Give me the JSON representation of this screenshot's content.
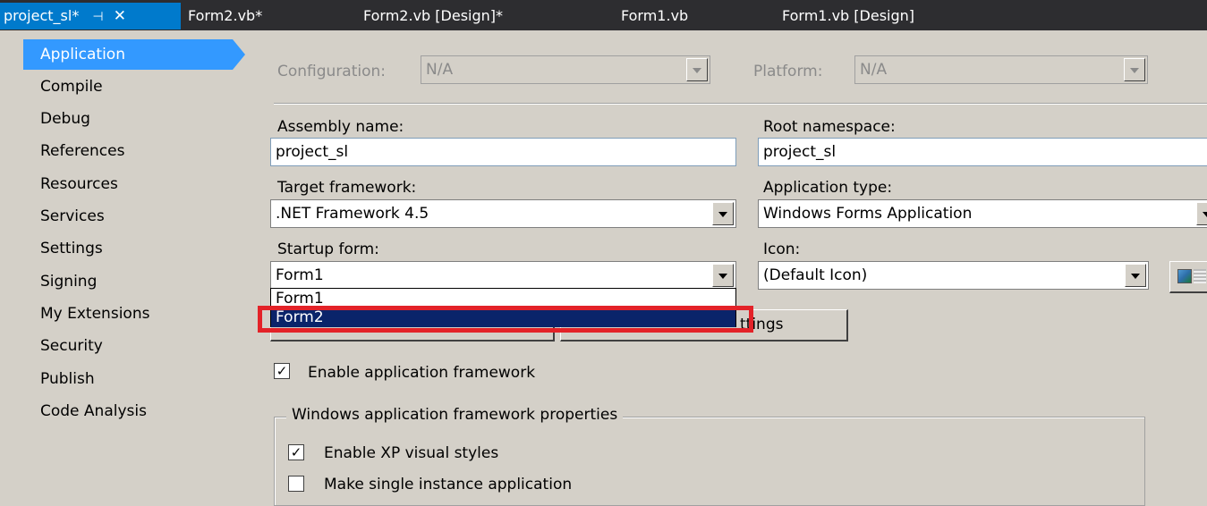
{
  "tabs": [
    {
      "label": "project_sl*",
      "active": true
    },
    {
      "label": "Form2.vb*"
    },
    {
      "label": "Form2.vb [Design]*"
    },
    {
      "label": "Form1.vb"
    },
    {
      "label": "Form1.vb [Design]"
    }
  ],
  "sidebar": {
    "items": [
      {
        "label": "Application",
        "active": true
      },
      {
        "label": "Compile"
      },
      {
        "label": "Debug"
      },
      {
        "label": "References"
      },
      {
        "label": "Resources"
      },
      {
        "label": "Services"
      },
      {
        "label": "Settings"
      },
      {
        "label": "Signing"
      },
      {
        "label": "My Extensions"
      },
      {
        "label": "Security"
      },
      {
        "label": "Publish"
      },
      {
        "label": "Code Analysis"
      }
    ]
  },
  "config": {
    "configuration_label": "Configuration:",
    "configuration_value": "N/A",
    "platform_label": "Platform:",
    "platform_value": "N/A"
  },
  "form": {
    "assembly_name_label": "Assembly name:",
    "assembly_name_value": "project_sl",
    "root_namespace_label": "Root namespace:",
    "root_namespace_value": "project_sl",
    "target_framework_label": "Target framework:",
    "target_framework_value": ".NET Framework 4.5",
    "application_type_label": "Application type:",
    "application_type_value": "Windows Forms Application",
    "startup_form_label": "Startup form:",
    "startup_form_value": "Form1",
    "icon_label": "Icon:",
    "icon_value": "(Default Icon)",
    "startup_options": [
      "Form1",
      "Form2"
    ],
    "selected_option": "Form2",
    "view_settings_button_partial": "ttings",
    "enable_framework_label": "Enable application framework",
    "enable_framework_checked": true
  },
  "framework_group": {
    "title": "Windows application framework properties",
    "xp_styles_label": "Enable XP visual styles",
    "xp_styles_checked": true,
    "single_instance_label": "Make single instance application",
    "single_instance_checked": false
  },
  "colors": {
    "tab_strip": "#2d2d30",
    "active_tab": "#007acc",
    "sidebar_active": "#3399ff",
    "list_selection": "#0a246a",
    "highlight_box": "#e32228",
    "window_bg": "#d4d0c8"
  }
}
